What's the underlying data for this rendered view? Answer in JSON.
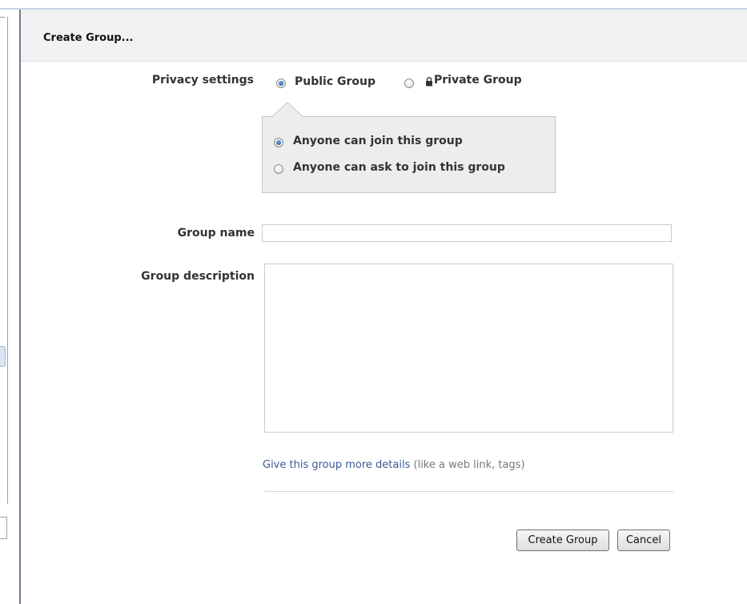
{
  "dialog": {
    "title": "Create Group..."
  },
  "privacy": {
    "label": "Privacy settings",
    "options": [
      {
        "label": "Public Group",
        "checked": true
      },
      {
        "label": "Private Group",
        "checked": false,
        "icon": "lock-icon"
      }
    ],
    "public_suboptions": [
      {
        "label": "Anyone can join this group",
        "checked": true
      },
      {
        "label": "Anyone can ask to join this group",
        "checked": false
      }
    ]
  },
  "group_name": {
    "label": "Group name",
    "value": "",
    "placeholder": ""
  },
  "group_description": {
    "label": "Group description",
    "value": "",
    "placeholder": ""
  },
  "details": {
    "link_text": "Give this group more details",
    "hint": " (like a web link, tags)"
  },
  "buttons": {
    "create": "Create Group",
    "cancel": "Cancel"
  },
  "colors": {
    "link": "#3b5998",
    "title_bar": "#f2f2f2",
    "popup_bg": "#ededed"
  }
}
